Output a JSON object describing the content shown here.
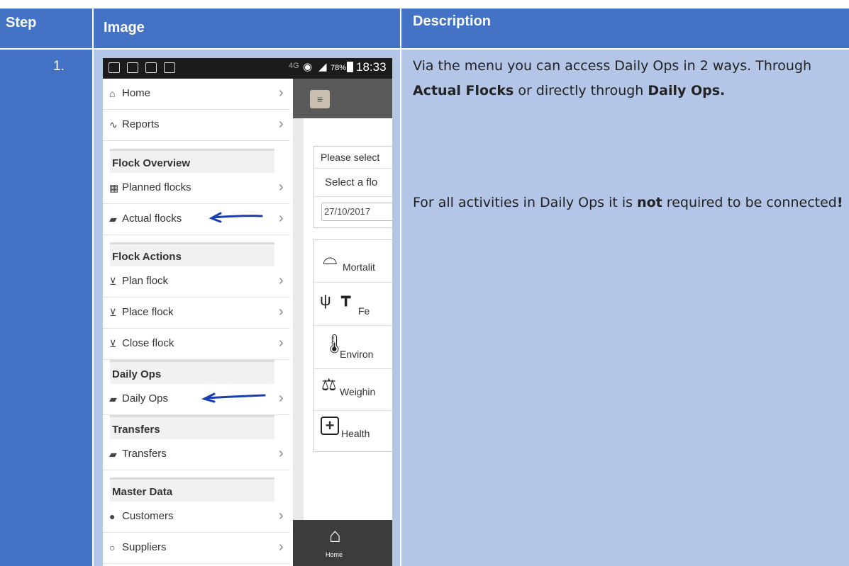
{
  "header": {
    "step": "Step",
    "image": "Image",
    "description": "Description"
  },
  "row": {
    "step_num": "1."
  },
  "description": {
    "p1_a": "Via the menu you can access Daily Ops in 2 ways. Through ",
    "p1_b": "Actual Flocks",
    "p1_c": " or directly through ",
    "p1_d": "Daily Ops.",
    "p2_a": "For all activities in Daily Ops it is ",
    "p2_b": "not",
    "p2_c": " required to be connected",
    "p2_d": "!"
  },
  "phone": {
    "status": {
      "battery": "78%",
      "time": "18:33",
      "network": "4G"
    },
    "menu": {
      "home": "Home",
      "reports": "Reports",
      "sections": {
        "flock_overview": "Flock Overview",
        "flock_actions": "Flock Actions",
        "daily_ops": "Daily Ops",
        "transfers": "Transfers",
        "master_data": "Master Data"
      },
      "items": {
        "planned_flocks": "Planned flocks",
        "actual_flocks": "Actual flocks",
        "plan_flock": "Plan flock",
        "place_flock": "Place flock",
        "close_flock": "Close flock",
        "daily_ops": "Daily Ops",
        "transfers": "Transfers",
        "customers": "Customers",
        "suppliers": "Suppliers"
      }
    },
    "content": {
      "please_select": "Please select",
      "select_flock": "Select a flo",
      "date": "27/10/2017",
      "actions": {
        "mortality": "Mortalit",
        "feed": "Fe",
        "environment": "Environ",
        "weighing": "Weighin",
        "health": "Health"
      },
      "home_label": "Home"
    }
  },
  "colors": {
    "header_blue": "#4472c4",
    "cell_blue": "#b4c6e7",
    "arrow_blue": "#1a3fb0"
  }
}
